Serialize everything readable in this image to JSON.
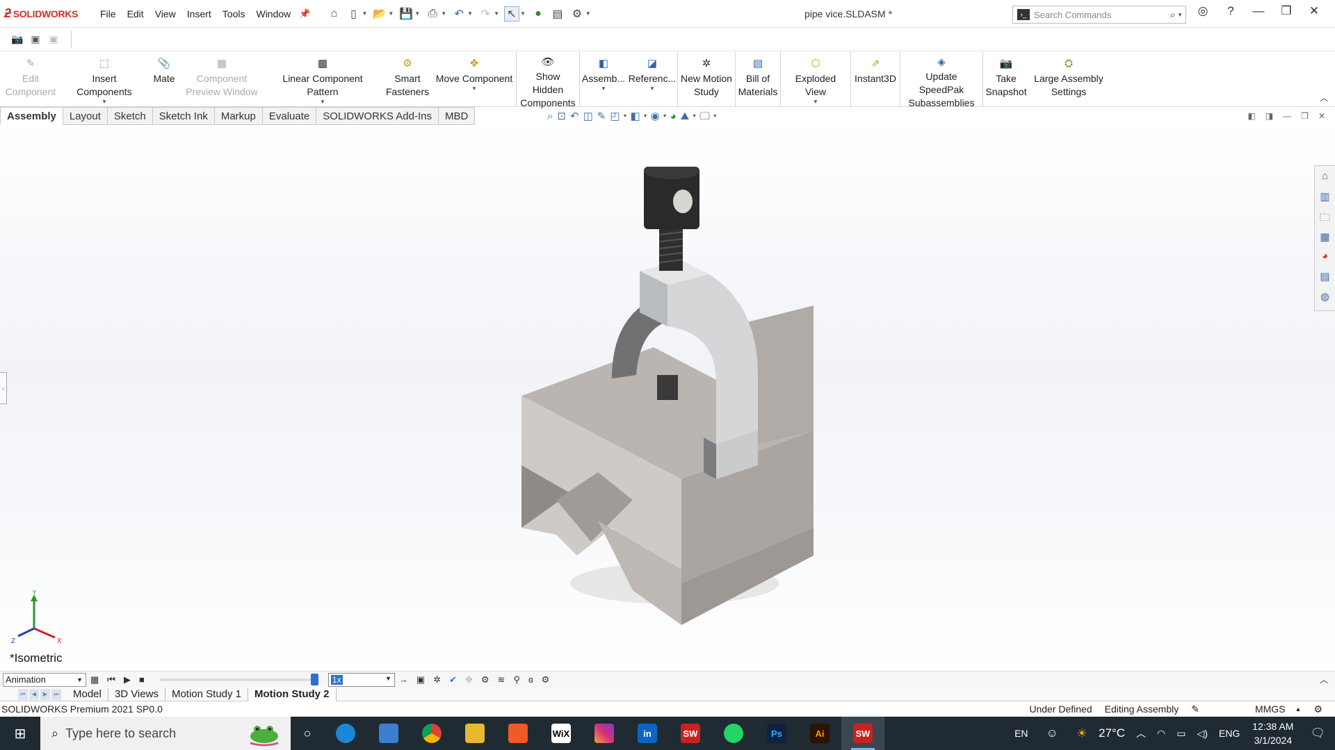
{
  "app": {
    "logo_text": "SOLIDWORKS",
    "doc_title": "pipe vice.SLDASM *",
    "menus": [
      "File",
      "Edit",
      "View",
      "Insert",
      "Tools",
      "Window"
    ],
    "search_placeholder": "Search Commands"
  },
  "commands": [
    {
      "line1": "Edit",
      "line2": "Component",
      "icon": "edit-component-icon",
      "disabled": true
    },
    {
      "line1": "Insert Components",
      "line2": "",
      "icon": "insert-components-icon",
      "dropdown": true
    },
    {
      "line1": "Mate",
      "line2": "",
      "icon": "mate-icon"
    },
    {
      "line1": "Component",
      "line2": "Preview Window",
      "icon": "preview-window-icon",
      "disabled": true
    },
    {
      "line1": "Linear Component Pattern",
      "line2": "",
      "icon": "linear-pattern-icon",
      "dropdown": true
    },
    {
      "line1": "Smart",
      "line2": "Fasteners",
      "icon": "smart-fasteners-icon"
    },
    {
      "line1": "Move Component",
      "line2": "",
      "icon": "move-component-icon",
      "dropdown": true
    },
    {
      "line1": "Show Hidden",
      "line2": "Components",
      "icon": "show-hidden-icon"
    },
    {
      "line1": "Assemb...",
      "line2": "",
      "icon": "assembly-features-icon",
      "dropdown": true
    },
    {
      "line1": "Referenc...",
      "line2": "",
      "icon": "reference-geometry-icon",
      "dropdown": true
    },
    {
      "line1": "New Motion",
      "line2": "Study",
      "icon": "new-motion-study-icon"
    },
    {
      "line1": "Bill of",
      "line2": "Materials",
      "icon": "bill-of-materials-icon"
    },
    {
      "line1": "Exploded View",
      "line2": "",
      "icon": "exploded-view-icon",
      "dropdown": true
    },
    {
      "line1": "Instant3D",
      "line2": "",
      "icon": "instant3d-icon"
    },
    {
      "line1": "Update SpeedPak",
      "line2": "Subassemblies",
      "icon": "speedpak-icon"
    },
    {
      "line1": "Take",
      "line2": "Snapshot",
      "icon": "snapshot-icon"
    },
    {
      "line1": "Large Assembly",
      "line2": "Settings",
      "icon": "large-assembly-icon"
    }
  ],
  "tabs": [
    "Assembly",
    "Layout",
    "Sketch",
    "Sketch Ink",
    "Markup",
    "Evaluate",
    "SOLIDWORKS Add-Ins",
    "MBD"
  ],
  "active_tab": "Assembly",
  "view": {
    "orientation_label": "*Isometric",
    "triad": {
      "y": "Y",
      "x": "X",
      "z": "Z"
    }
  },
  "motion": {
    "study_type": "Animation",
    "speed": "1x",
    "progress_fraction": 1.0
  },
  "study_tabs": [
    "Model",
    "3D Views",
    "Motion Study 1",
    "Motion Study 2"
  ],
  "active_study_tab": "Motion Study 2",
  "status": {
    "left": "SOLIDWORKS Premium 2021 SP0.0",
    "state": "Under Defined",
    "mode": "Editing Assembly",
    "units": "MMGS"
  },
  "taskbar": {
    "search_placeholder": "Type here to search",
    "apps": [
      {
        "name": "edge",
        "label": "",
        "color": "#1b88d4"
      },
      {
        "name": "laptop",
        "label": "",
        "color": "#3b7fd0"
      },
      {
        "name": "chrome",
        "label": "",
        "color": "#e4a81b"
      },
      {
        "name": "file-explorer",
        "label": "",
        "color": "#e6b930"
      },
      {
        "name": "brave",
        "label": "",
        "color": "#f05a24"
      },
      {
        "name": "wix",
        "label": "WiX",
        "color": "#ffffff"
      },
      {
        "name": "instagram",
        "label": "",
        "color": "#d6307a"
      },
      {
        "name": "linkedin",
        "label": "in",
        "color": "#0a66c2"
      },
      {
        "name": "solidworks-2021",
        "label": "SW",
        "color": "#c8221e"
      },
      {
        "name": "whatsapp",
        "label": "",
        "color": "#25d366"
      },
      {
        "name": "photoshop",
        "label": "Ps",
        "color": "#0f2340"
      },
      {
        "name": "illustrator",
        "label": "Ai",
        "color": "#2b1300"
      },
      {
        "name": "solidworks-active",
        "label": "SW",
        "color": "#c8221e"
      }
    ],
    "tray": {
      "lang": "EN",
      "temperature": "27°C",
      "input_lang": "ENG",
      "time": "12:38 AM",
      "date": "3/1/2024"
    }
  }
}
